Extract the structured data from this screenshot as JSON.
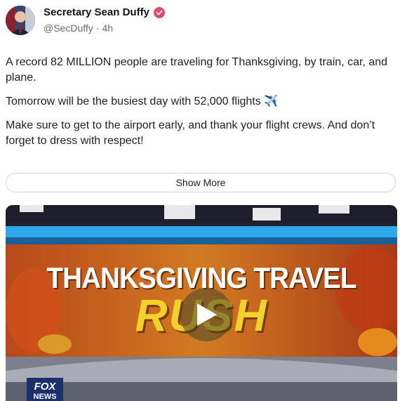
{
  "post": {
    "author": {
      "name": "Secretary Sean Duffy",
      "handle": "@SecDuffy",
      "time": "4h"
    },
    "paragraphs": [
      "A record 82 MILLION people are traveling for Thanksgiving, by train, car, and plane.",
      "Tomorrow will be the busiest day with 52,000 flights ✈️",
      "Make sure to get to the airport early, and thank your flight crews. And don’t forget to dress with respect!"
    ],
    "show_more_label": "Show More"
  },
  "video": {
    "headline_top": "THANKSGIVING TRAVEL",
    "headline_bottom": "RUSH",
    "network_logo": "FOX NEWS"
  },
  "colors": {
    "verified_badge": "#e64a6a",
    "headline_yellow": "#f2d22a",
    "studio_blue": "#2fa8e8"
  }
}
